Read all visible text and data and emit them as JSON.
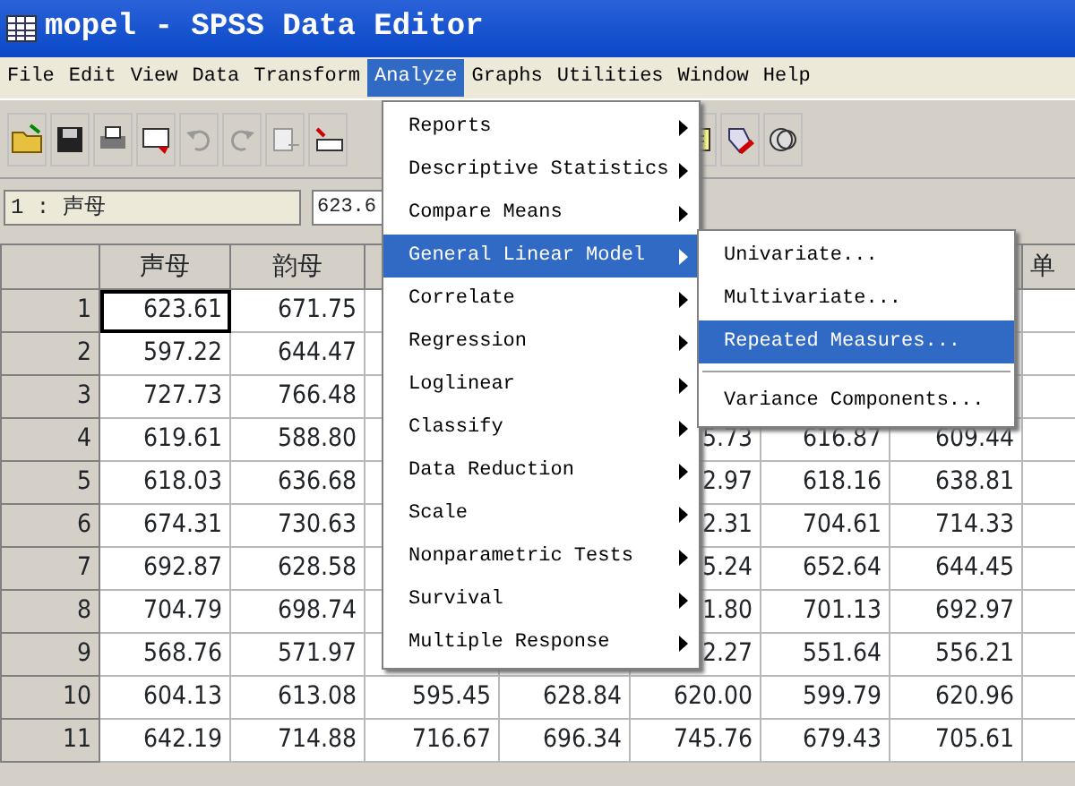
{
  "window": {
    "title": "mopel - SPSS Data Editor"
  },
  "menu_bar": [
    {
      "label": "File",
      "selected": false
    },
    {
      "label": "Edit",
      "selected": false
    },
    {
      "label": "View",
      "selected": false
    },
    {
      "label": "Data",
      "selected": false
    },
    {
      "label": "Transform",
      "selected": false
    },
    {
      "label": "Analyze",
      "selected": true
    },
    {
      "label": "Graphs",
      "selected": false
    },
    {
      "label": "Utilities",
      "selected": false
    },
    {
      "label": "Window",
      "selected": false
    },
    {
      "label": "Help",
      "selected": false
    }
  ],
  "cell_editor": {
    "cell_ref": "1 : 声母",
    "value": "623.6"
  },
  "grid": {
    "columns": [
      {
        "label": "声母"
      },
      {
        "label": "韵母"
      },
      {},
      {},
      {},
      {},
      {},
      {
        "label": "单"
      }
    ],
    "rows": [
      {
        "label": "1",
        "selected": true,
        "cells": [
          "623.61",
          "671.75",
          null,
          null,
          null,
          null,
          null,
          null
        ]
      },
      {
        "label": "2",
        "selected": false,
        "cells": [
          "597.22",
          "644.47",
          null,
          null,
          null,
          null,
          null,
          null
        ]
      },
      {
        "label": "3",
        "selected": false,
        "cells": [
          "727.73",
          "766.48",
          null,
          null,
          null,
          null,
          null,
          null
        ]
      },
      {
        "label": "4",
        "selected": false,
        "cells": [
          "619.61",
          "588.80",
          null,
          null,
          "5.73",
          "616.87",
          "609.44",
          null
        ]
      },
      {
        "label": "5",
        "selected": false,
        "cells": [
          "618.03",
          "636.68",
          null,
          null,
          "2.97",
          "618.16",
          "638.81",
          null
        ]
      },
      {
        "label": "6",
        "selected": false,
        "cells": [
          "674.31",
          "730.63",
          null,
          null,
          "2.31",
          "704.61",
          "714.33",
          null
        ]
      },
      {
        "label": "7",
        "selected": false,
        "cells": [
          "692.87",
          "628.58",
          null,
          null,
          "5.24",
          "652.64",
          "644.45",
          null
        ]
      },
      {
        "label": "8",
        "selected": false,
        "cells": [
          "704.79",
          "698.74",
          null,
          null,
          "1.80",
          "701.13",
          "692.97",
          null
        ]
      },
      {
        "label": "9",
        "selected": false,
        "cells": [
          "568.76",
          "571.97",
          null,
          null,
          "2.27",
          "551.64",
          "556.21",
          null
        ]
      },
      {
        "label": "10",
        "selected": false,
        "cells": [
          "604.13",
          "613.08",
          "595.45",
          "628.84",
          "620.00",
          "599.79",
          "620.96",
          null
        ]
      },
      {
        "label": "11",
        "selected": false,
        "cells": [
          "642.19",
          "714.88",
          "716.67",
          "696.34",
          "745.76",
          "679.43",
          "705.61",
          null
        ]
      }
    ]
  },
  "analyze_menu": [
    {
      "label": "Reports",
      "selected": false
    },
    {
      "label": "Descriptive Statistics",
      "selected": false
    },
    {
      "label": "Compare Means",
      "selected": false
    },
    {
      "label": "General Linear Model",
      "selected": true
    },
    {
      "label": "Correlate",
      "selected": false
    },
    {
      "label": "Regression",
      "selected": false
    },
    {
      "label": "Loglinear",
      "selected": false
    },
    {
      "label": "Classify",
      "selected": false
    },
    {
      "label": "Data Reduction",
      "selected": false
    },
    {
      "label": "Scale",
      "selected": false
    },
    {
      "label": "Nonparametric Tests",
      "selected": false
    },
    {
      "label": "Survival",
      "selected": false
    },
    {
      "label": "Multiple Response",
      "selected": false
    }
  ],
  "submenu": [
    {
      "kind": "item",
      "label": "Univariate...",
      "selected": false
    },
    {
      "kind": "item",
      "label": "Multivariate...",
      "selected": false
    },
    {
      "kind": "item",
      "label": "Repeated Measures...",
      "selected": true
    },
    {
      "kind": "separator"
    },
    {
      "kind": "item",
      "label": "Variance Components...",
      "selected": false
    }
  ]
}
